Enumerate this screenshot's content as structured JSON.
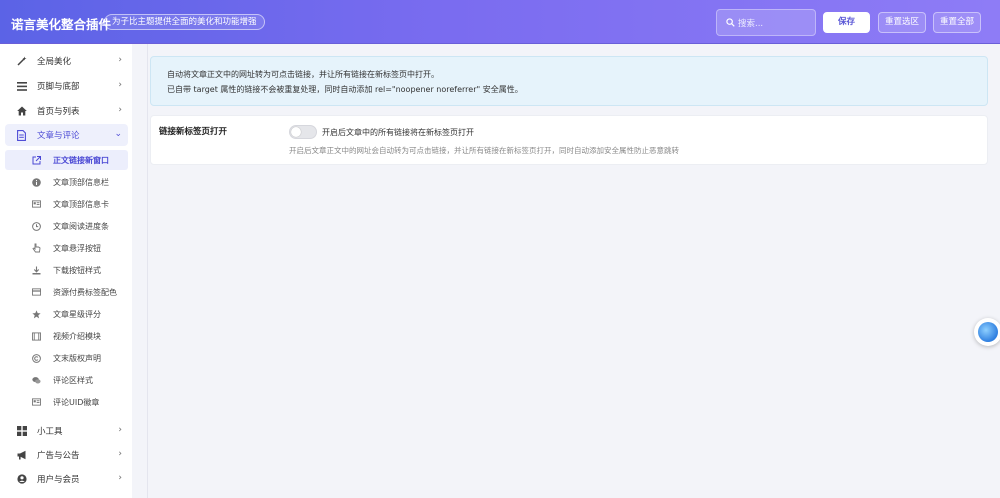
{
  "header": {
    "brand": "诺言美化整合插件",
    "tagline": "为子比主题提供全面的美化和功能增强",
    "search_placeholder": "搜索...",
    "save_label": "保存",
    "reset_selection_label": "重置选区",
    "reset_all_label": "重置全部"
  },
  "sidebar": {
    "items": [
      {
        "label": "全局美化",
        "icon": "magic-wand-icon"
      },
      {
        "label": "页脚与底部",
        "icon": "bars-icon"
      },
      {
        "label": "首页与列表",
        "icon": "home-icon"
      },
      {
        "label": "文章与评论",
        "icon": "document-icon"
      },
      {
        "label": "小工具",
        "icon": "grid-icon"
      },
      {
        "label": "广告与公告",
        "icon": "megaphone-icon"
      },
      {
        "label": "用户与会员",
        "icon": "user-circle-icon"
      }
    ],
    "subitems": [
      {
        "label": "正文链接新窗口",
        "icon": "external-link-icon"
      },
      {
        "label": "文章顶部信息栏",
        "icon": "info-icon"
      },
      {
        "label": "文章顶部信息卡",
        "icon": "id-card-icon"
      },
      {
        "label": "文章阅读进度条",
        "icon": "clock-icon"
      },
      {
        "label": "文章悬浮按钮",
        "icon": "hand-pointer-icon"
      },
      {
        "label": "下载按钮样式",
        "icon": "download-icon"
      },
      {
        "label": "资源付费标签配色",
        "icon": "credit-card-icon"
      },
      {
        "label": "文章星级评分",
        "icon": "star-icon"
      },
      {
        "label": "视频介绍模块",
        "icon": "film-icon"
      },
      {
        "label": "文末版权声明",
        "icon": "copyright-icon"
      },
      {
        "label": "评论区样式",
        "icon": "comments-icon"
      },
      {
        "label": "评论UID徽章",
        "icon": "id-badge-icon"
      }
    ]
  },
  "notice": {
    "line1": "自动将文章正文中的网址转为可点击链接，并让所有链接在新标签页中打开。",
    "line2": "已自带 target 属性的链接不会被重复处理，同时自动添加 rel=\"noopener noreferrer\" 安全属性。"
  },
  "setting": {
    "label": "链接新标签页打开",
    "toggle_label": "开启后文章中的所有链接将在新标签页打开",
    "toggle_on": false,
    "description": "开启后文章正文中的网址会自动转为可点击链接，并让所有链接在新标签页打开，同时自动添加安全属性防止恶意跳转"
  },
  "colors": {
    "header_start": "#5b63e6",
    "header_end": "#8e7cf6",
    "accent": "#4f4dd6",
    "notice_bg": "#e6f3fb"
  }
}
